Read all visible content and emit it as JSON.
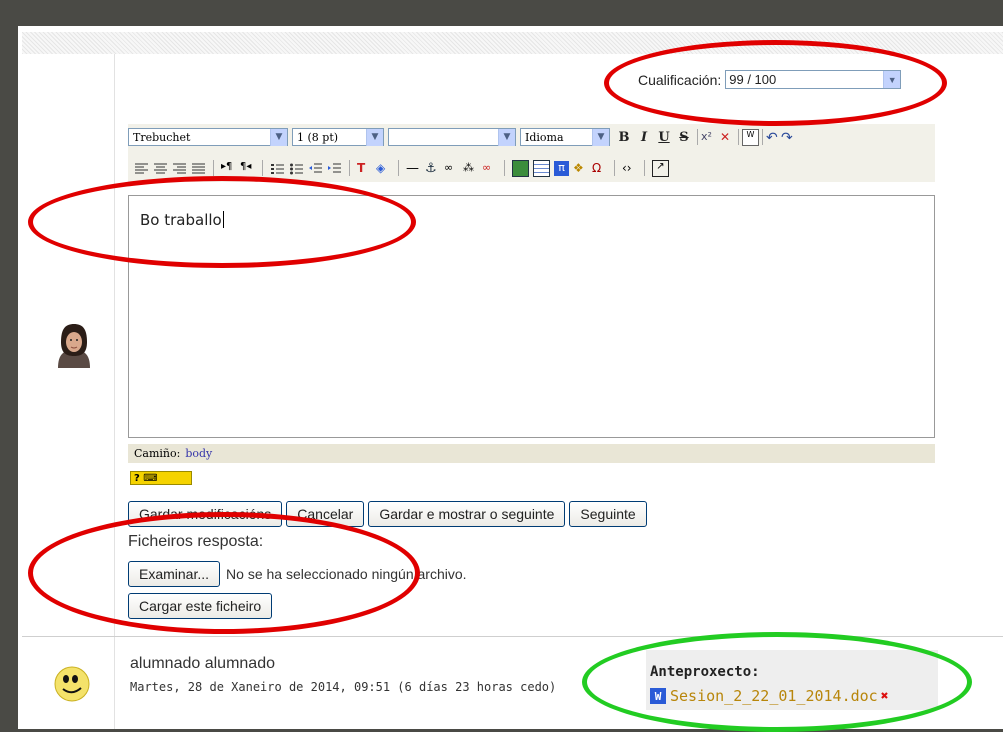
{
  "grade": {
    "label": "Cualificación:",
    "value": "99 / 100"
  },
  "toolbar": {
    "font_family": "Trebuchet",
    "font_size": "1 (8 pt)",
    "format_value": "",
    "language": "Idioma",
    "bold": "B",
    "italic": "I",
    "underline": "U",
    "strike": "S",
    "icons": [
      "align-left-icon",
      "align-center-icon",
      "align-right-icon",
      "justify-icon",
      "ltr-icon",
      "rtl-icon",
      "ordered-list-icon",
      "unordered-list-icon",
      "outdent-icon",
      "indent-icon",
      "text-color-icon",
      "bg-color-icon",
      "horizontal-rule-icon",
      "anchor-icon",
      "link-icon",
      "unlink-icon",
      "nolink-icon",
      "image-icon",
      "table-icon",
      "equation-icon",
      "emoticon-icon",
      "special-char-icon",
      "html-source-icon",
      "fullscreen-icon"
    ]
  },
  "editor": {
    "content": "Bo traballo"
  },
  "path": {
    "label": "Camiño:",
    "value": "body"
  },
  "buttons": {
    "save": "Gardar modificacións",
    "cancel": "Cancelar",
    "save_next": "Gardar e mostrar o seguinte",
    "next": "Seguinte"
  },
  "files": {
    "label": "Ficheiros resposta:",
    "browse": "Examinar...",
    "none_selected": "No se ha seleccionado ningún archivo.",
    "upload": "Cargar este ficheiro"
  },
  "submission": {
    "user": "alumnado alumnado",
    "date": "Martes, 28 de Xaneiro de 2014, 09:51 (6 días 23 horas cedo)",
    "attachment_title": "Anteproxecto:",
    "attachment_file": "Sesion_2_22_01_2014.doc"
  },
  "colors": {
    "highlight_red": "#e00000",
    "highlight_green": "#22cc22",
    "attachment_link": "#b8860b"
  }
}
